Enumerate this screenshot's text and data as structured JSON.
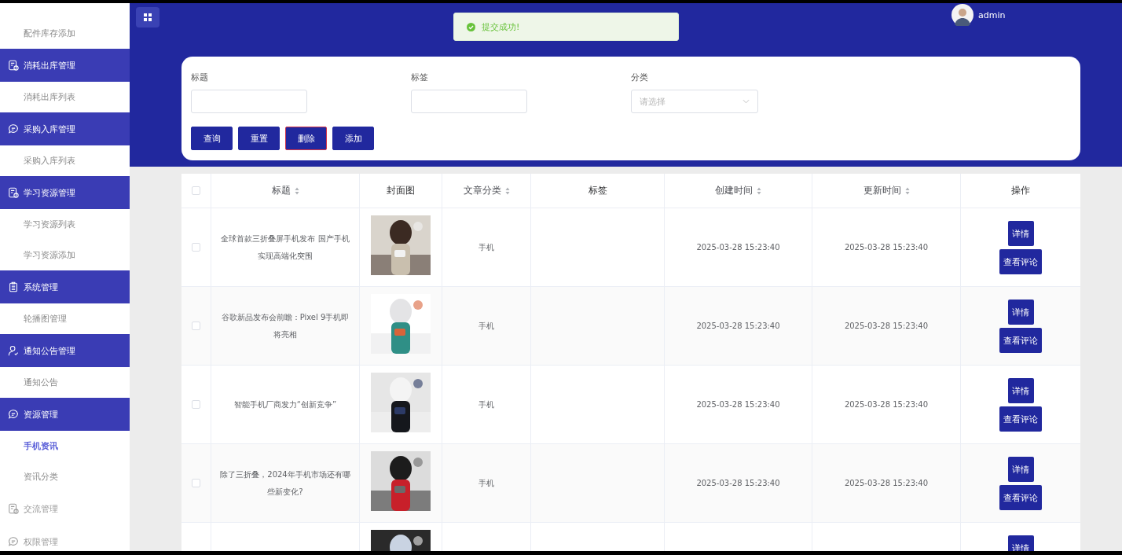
{
  "sidebar": {
    "items": [
      {
        "label": "配件库存添加",
        "kind": "child",
        "selected": false
      },
      {
        "label": "消耗出库管理",
        "kind": "group",
        "expanded": true
      },
      {
        "label": "消耗出库列表",
        "kind": "child",
        "selected": false
      },
      {
        "label": "采购入库管理",
        "kind": "group",
        "expanded": true
      },
      {
        "label": "采购入库列表",
        "kind": "child",
        "selected": false
      },
      {
        "label": "学习资源管理",
        "kind": "group",
        "expanded": true
      },
      {
        "label": "学习资源列表",
        "kind": "child",
        "selected": false
      },
      {
        "label": "学习资源添加",
        "kind": "child",
        "selected": false
      },
      {
        "label": "系统管理",
        "kind": "group",
        "expanded": true
      },
      {
        "label": "轮播图管理",
        "kind": "child",
        "selected": false
      },
      {
        "label": "通知公告管理",
        "kind": "group",
        "expanded": true
      },
      {
        "label": "通知公告",
        "kind": "child",
        "selected": false
      },
      {
        "label": "资源管理",
        "kind": "group",
        "expanded": true
      },
      {
        "label": "手机资讯",
        "kind": "child",
        "selected": true
      },
      {
        "label": "资讯分类",
        "kind": "child",
        "selected": false
      },
      {
        "label": "交流管理",
        "kind": "group",
        "expanded": false
      },
      {
        "label": "权限管理",
        "kind": "group",
        "expanded": false
      }
    ]
  },
  "toast": {
    "message": "提交成功!"
  },
  "user": {
    "name": "admin"
  },
  "search_form": {
    "fields": [
      {
        "label": "标题",
        "kind": "input"
      },
      {
        "label": "标签",
        "kind": "input"
      },
      {
        "label": "分类",
        "kind": "select",
        "placeholder": "请选择"
      }
    ],
    "buttons": [
      {
        "label": "查询",
        "kind": "normal"
      },
      {
        "label": "重置",
        "kind": "normal"
      },
      {
        "label": "删除",
        "kind": "danger"
      },
      {
        "label": "添加",
        "kind": "normal"
      }
    ]
  },
  "table": {
    "select_all": {
      "checked": false
    },
    "columns": [
      {
        "label": "标题",
        "sortable": true
      },
      {
        "label": "封面图",
        "sortable": false
      },
      {
        "label": "文章分类",
        "sortable": true
      },
      {
        "label": "标签",
        "sortable": false
      },
      {
        "label": "创建时间",
        "sortable": true
      },
      {
        "label": "更新时间",
        "sortable": true
      },
      {
        "label": "操作",
        "sortable": false
      }
    ],
    "rows": [
      {
        "checked": false,
        "title": "全球首款三折叠屏手机发布 国产手机实现高端化突围",
        "cover": {
          "kind": "picture"
        },
        "category": "手机",
        "created": "2025-03-28 15:23:40",
        "updated": "2025-03-28 15:23:40",
        "actions": [
          "详情",
          "查看评论"
        ]
      },
      {
        "checked": false,
        "title": "谷歌新品发布会前瞻：Pixel 9手机即将亮相",
        "cover": {
          "kind": "picture"
        },
        "category": "手机",
        "created": "2025-03-28 15:23:40",
        "updated": "2025-03-28 15:23:40",
        "actions": [
          "详情",
          "查看评论"
        ]
      },
      {
        "checked": false,
        "title": "智能手机厂商发力“创新竞争”",
        "cover": {
          "kind": "picture"
        },
        "category": "手机",
        "created": "2025-03-28 15:23:40",
        "updated": "2025-03-28 15:23:40",
        "actions": [
          "详情",
          "查看评论"
        ]
      },
      {
        "checked": false,
        "title": "除了三折叠，2024年手机市场还有哪些新变化?",
        "cover": {
          "kind": "picture"
        },
        "category": "手机",
        "created": "2025-03-28 15:23:40",
        "updated": "2025-03-28 15:23:40",
        "actions": [
          "详情",
          "查看评论"
        ]
      },
      {
        "cover": {
          "kind": "picture"
        },
        "actions": [
          "详情"
        ]
      }
    ]
  }
}
